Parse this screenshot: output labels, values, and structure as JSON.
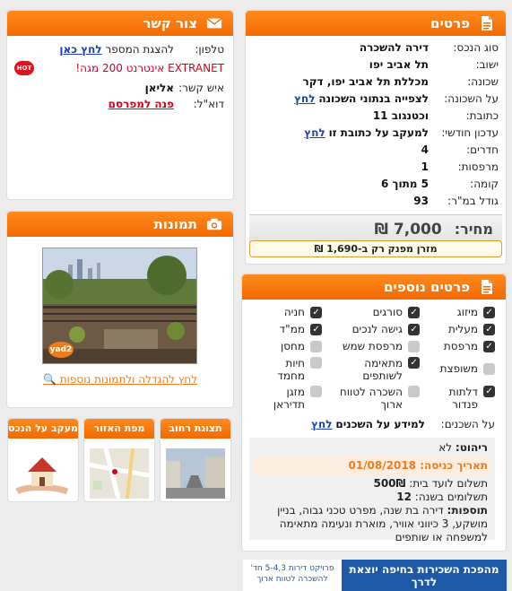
{
  "details": {
    "title": "פרטים",
    "rows": [
      {
        "label": "סוג הנכס:",
        "value": "דירה להשכרה"
      },
      {
        "label": "ישוב:",
        "value": "תל אביב יפו"
      },
      {
        "label": "שכונה:",
        "value": "מכללת תל אביב יפו, דקר"
      },
      {
        "label": "על השכונה:",
        "value": "לצפייה בנתוני השכונה",
        "link": "לחץ"
      },
      {
        "label": "כתובת:",
        "value": "וכטנגוב 11"
      },
      {
        "label": "עדכון חודשי:",
        "value": "למעקב על כתובת זו",
        "link": "לחץ"
      },
      {
        "label": "חדרים:",
        "value": "4"
      },
      {
        "label": "מרפסות:",
        "value": "1"
      },
      {
        "label": "קומה:",
        "value": "5 מתוך 6"
      },
      {
        "label": "גודל במ\"ר:",
        "value": "93"
      }
    ],
    "price_label": "מחיר:",
    "price_value": "7,000 ₪",
    "cash_text": "מזרן מפנק רק ב-1,690 ₪"
  },
  "contact": {
    "title": "צור קשר",
    "phone_label": "טלפון:",
    "phone_text": "להצגת המספר",
    "phone_link": "לחץ כאן",
    "promo_text": "EXTRANET אינטרנט 200 מגה!",
    "promo_badge": "HOT",
    "person_label": "איש קשר:",
    "person_name": "אליאן",
    "email_label": "דוא\"ל:",
    "email_link": "פנה למפרסם"
  },
  "photos": {
    "title": "תמונות",
    "watermark": "yad2",
    "enlarge_text": "לחץ להגדלה ולתמונות נוספות"
  },
  "tiles": [
    {
      "title": "תצוגת רחוב"
    },
    {
      "title": "מפת האזור"
    },
    {
      "title": "מעקב על הנכס"
    }
  ],
  "more": {
    "title": "פרטים נוספים",
    "rows": [
      [
        {
          "label": "מיזוג",
          "checked": true
        },
        {
          "label": "סורגים",
          "checked": true
        },
        {
          "label": "חניה",
          "checked": true
        }
      ],
      [
        {
          "label": "מעלית",
          "checked": true
        },
        {
          "label": "גישה לנכים",
          "checked": true
        },
        {
          "label": "ממ\"ד",
          "checked": true
        }
      ],
      [
        {
          "label": "מרפסת",
          "checked": true
        },
        {
          "label": "מרפסת שמש",
          "checked": false
        },
        {
          "label": "מחסן",
          "checked": false
        }
      ],
      [
        {
          "label": "משופצת",
          "checked": false
        },
        {
          "label": "מתאימה לשותפים",
          "checked": true
        },
        {
          "label": "חיות מחמד",
          "checked": false
        }
      ],
      [
        {
          "label": "דלתות פנדור",
          "checked": true
        },
        {
          "label": "השכרה לטווח ארוך",
          "checked": false
        },
        {
          "label": "מזגן תדיראן",
          "checked": false
        }
      ]
    ],
    "tenants_label": "על השכנים:",
    "tenants_text": "למידע על השכנים",
    "tenants_link": "לחץ",
    "furniture_label": "ריהוט:",
    "furniture_value": "לא",
    "entry_label": "תאריך כניסה:",
    "entry_value": "01/08/2018",
    "vaad_label": "תשלום לועד בית:",
    "vaad_value": "500₪",
    "payments_label": "תשלומים בשנה:",
    "payments_value": "12",
    "extras_label": "תוספות:",
    "extras_value": "דירה בת שנה, מפרט טכני גבוה, בניין מושקע, 3 כיווני אוויר, מוארת ונעימה מתאימה למשפחה או שותפים"
  },
  "banner": {
    "main": "מהפכת השכירות בחיפה יוצאת לדרך",
    "sub": "פרויקט דירות 5-4,3 חד' להשכרה לטווח ארוך"
  }
}
